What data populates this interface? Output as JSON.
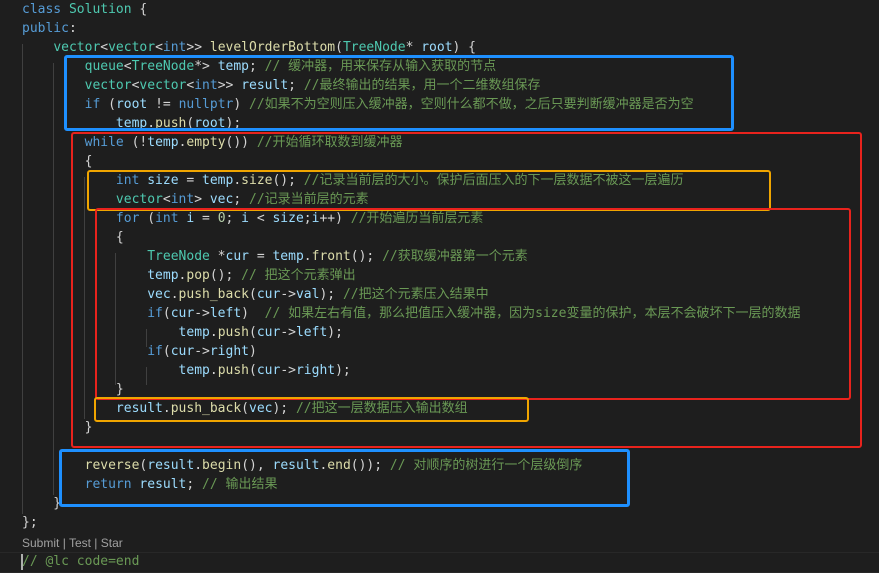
{
  "code": {
    "l01": {
      "a": "class ",
      "b": "Solution",
      " c": ""
    },
    "lines": [
      [
        [
          "kw",
          "class "
        ],
        [
          "ty",
          "Solution"
        ],
        [
          "pl",
          " {"
        ]
      ],
      [
        [
          "kw",
          "public"
        ],
        [
          "pl",
          ":"
        ]
      ],
      [
        [
          "pl",
          "    "
        ],
        [
          "ty",
          "vector"
        ],
        [
          "pl",
          "<"
        ],
        [
          "ty",
          "vector"
        ],
        [
          "pl",
          "<"
        ],
        [
          "kw",
          "int"
        ],
        [
          "pl",
          ">> "
        ],
        [
          "fn",
          "levelOrderBottom"
        ],
        [
          "pl",
          "("
        ],
        [
          "ty",
          "TreeNode"
        ],
        [
          "pl",
          "* "
        ],
        [
          "vr",
          "root"
        ],
        [
          "pl",
          ") {"
        ]
      ],
      [
        [
          "pl",
          "        "
        ],
        [
          "ty",
          "queue"
        ],
        [
          "pl",
          "<"
        ],
        [
          "ty",
          "TreeNode"
        ],
        [
          "pl",
          "*> "
        ],
        [
          "vr",
          "temp"
        ],
        [
          "pl",
          "; "
        ],
        [
          "cm",
          "// 缓冲器，用来保存从输入获取的节点"
        ]
      ],
      [
        [
          "pl",
          "        "
        ],
        [
          "ty",
          "vector"
        ],
        [
          "pl",
          "<"
        ],
        [
          "ty",
          "vector"
        ],
        [
          "pl",
          "<"
        ],
        [
          "kw",
          "int"
        ],
        [
          "pl",
          ">> "
        ],
        [
          "vr",
          "result"
        ],
        [
          "pl",
          "; "
        ],
        [
          "cm",
          "//最终输出的结果，用一个二维数组保存"
        ]
      ],
      [
        [
          "pl",
          "        "
        ],
        [
          "kw",
          "if"
        ],
        [
          "pl",
          " ("
        ],
        [
          "vr",
          "root"
        ],
        [
          "pl",
          " != "
        ],
        [
          "kw",
          "nullptr"
        ],
        [
          "pl",
          ") "
        ],
        [
          "cm",
          "//如果不为空则压入缓冲器，空则什么都不做，之后只要判断缓冲器是否为空"
        ]
      ],
      [
        [
          "pl",
          "            "
        ],
        [
          "vr",
          "temp"
        ],
        [
          "pl",
          "."
        ],
        [
          "fn",
          "push"
        ],
        [
          "pl",
          "("
        ],
        [
          "vr",
          "root"
        ],
        [
          "pl",
          ");"
        ]
      ],
      [
        [
          "pl",
          "        "
        ],
        [
          "kw",
          "while"
        ],
        [
          "pl",
          " (!"
        ],
        [
          "vr",
          "temp"
        ],
        [
          "pl",
          "."
        ],
        [
          "fn",
          "empty"
        ],
        [
          "pl",
          "()) "
        ],
        [
          "cm",
          "//开始循环取数到缓冲器"
        ]
      ],
      [
        [
          "pl",
          "        {"
        ]
      ],
      [
        [
          "pl",
          "            "
        ],
        [
          "kw",
          "int"
        ],
        [
          "pl",
          " "
        ],
        [
          "vr",
          "size"
        ],
        [
          "pl",
          " = "
        ],
        [
          "vr",
          "temp"
        ],
        [
          "pl",
          "."
        ],
        [
          "fn",
          "size"
        ],
        [
          "pl",
          "(); "
        ],
        [
          "cm",
          "//记录当前层的大小。保护后面压入的下一层数据不被这一层遍历"
        ]
      ],
      [
        [
          "pl",
          "            "
        ],
        [
          "ty",
          "vector"
        ],
        [
          "pl",
          "<"
        ],
        [
          "kw",
          "int"
        ],
        [
          "pl",
          "> "
        ],
        [
          "vr",
          "vec"
        ],
        [
          "pl",
          "; "
        ],
        [
          "cm",
          "//记录当前层的元素"
        ]
      ],
      [
        [
          "pl",
          "            "
        ],
        [
          "kw",
          "for"
        ],
        [
          "pl",
          " ("
        ],
        [
          "kw",
          "int"
        ],
        [
          "pl",
          " "
        ],
        [
          "vr",
          "i"
        ],
        [
          "pl",
          " = "
        ],
        [
          "nm",
          "0"
        ],
        [
          "pl",
          "; "
        ],
        [
          "vr",
          "i"
        ],
        [
          "pl",
          " < "
        ],
        [
          "vr",
          "size"
        ],
        [
          "pl",
          ";"
        ],
        [
          "vr",
          "i"
        ],
        [
          "pl",
          "++) "
        ],
        [
          "cm",
          "//开始遍历当前层元素"
        ]
      ],
      [
        [
          "pl",
          "            {"
        ]
      ],
      [
        [
          "pl",
          "                "
        ],
        [
          "ty",
          "TreeNode"
        ],
        [
          "pl",
          " *"
        ],
        [
          "vr",
          "cur"
        ],
        [
          "pl",
          " = "
        ],
        [
          "vr",
          "temp"
        ],
        [
          "pl",
          "."
        ],
        [
          "fn",
          "front"
        ],
        [
          "pl",
          "(); "
        ],
        [
          "cm",
          "//获取缓冲器第一个元素"
        ]
      ],
      [
        [
          "pl",
          "                "
        ],
        [
          "vr",
          "temp"
        ],
        [
          "pl",
          "."
        ],
        [
          "fn",
          "pop"
        ],
        [
          "pl",
          "(); "
        ],
        [
          "cm",
          "// 把这个元素弹出"
        ]
      ],
      [
        [
          "pl",
          "                "
        ],
        [
          "vr",
          "vec"
        ],
        [
          "pl",
          "."
        ],
        [
          "fn",
          "push_back"
        ],
        [
          "pl",
          "("
        ],
        [
          "vr",
          "cur"
        ],
        [
          "pl",
          "->"
        ],
        [
          "vr",
          "val"
        ],
        [
          "pl",
          "); "
        ],
        [
          "cm",
          "//把这个元素压入结果中"
        ]
      ],
      [
        [
          "pl",
          "                "
        ],
        [
          "kw",
          "if"
        ],
        [
          "pl",
          "("
        ],
        [
          "vr",
          "cur"
        ],
        [
          "pl",
          "->"
        ],
        [
          "vr",
          "left"
        ],
        [
          "pl",
          ")  "
        ],
        [
          "cm",
          "// 如果左右有值，那么把值压入缓冲器，因为size变量的保护，本层不会破坏下一层的数据"
        ]
      ],
      [
        [
          "pl",
          "                    "
        ],
        [
          "vr",
          "temp"
        ],
        [
          "pl",
          "."
        ],
        [
          "fn",
          "push"
        ],
        [
          "pl",
          "("
        ],
        [
          "vr",
          "cur"
        ],
        [
          "pl",
          "->"
        ],
        [
          "vr",
          "left"
        ],
        [
          "pl",
          ");"
        ]
      ],
      [
        [
          "pl",
          "                "
        ],
        [
          "kw",
          "if"
        ],
        [
          "pl",
          "("
        ],
        [
          "vr",
          "cur"
        ],
        [
          "pl",
          "->"
        ],
        [
          "vr",
          "right"
        ],
        [
          "pl",
          ")"
        ]
      ],
      [
        [
          "pl",
          "                    "
        ],
        [
          "vr",
          "temp"
        ],
        [
          "pl",
          "."
        ],
        [
          "fn",
          "push"
        ],
        [
          "pl",
          "("
        ],
        [
          "vr",
          "cur"
        ],
        [
          "pl",
          "->"
        ],
        [
          "vr",
          "right"
        ],
        [
          "pl",
          ");"
        ]
      ],
      [
        [
          "pl",
          "            }"
        ]
      ],
      [
        [
          "pl",
          "            "
        ],
        [
          "vr",
          "result"
        ],
        [
          "pl",
          "."
        ],
        [
          "fn",
          "push_back"
        ],
        [
          "pl",
          "("
        ],
        [
          "vr",
          "vec"
        ],
        [
          "pl",
          "); "
        ],
        [
          "cm",
          "//把这一层数据压入输出数组"
        ]
      ],
      [
        [
          "pl",
          "        }"
        ]
      ],
      [
        [
          "pl",
          ""
        ]
      ],
      [
        [
          "pl",
          "        "
        ],
        [
          "fn",
          "reverse"
        ],
        [
          "pl",
          "("
        ],
        [
          "vr",
          "result"
        ],
        [
          "pl",
          "."
        ],
        [
          "fn",
          "begin"
        ],
        [
          "pl",
          "(), "
        ],
        [
          "vr",
          "result"
        ],
        [
          "pl",
          "."
        ],
        [
          "fn",
          "end"
        ],
        [
          "pl",
          "()); "
        ],
        [
          "cm",
          "// 对顺序的树进行一个层级倒序"
        ]
      ],
      [
        [
          "pl",
          "        "
        ],
        [
          "kw",
          "return"
        ],
        [
          "pl",
          " "
        ],
        [
          "vr",
          "result"
        ],
        [
          "pl",
          "; "
        ],
        [
          "cm",
          "// 输出结果"
        ]
      ],
      [
        [
          "pl",
          "    }"
        ]
      ],
      [
        [
          "pl",
          "};"
        ]
      ]
    ],
    "last_line": "// @lc code=end"
  },
  "codelens": {
    "submit": "Submit",
    "sep1": " | ",
    "test": "Test",
    "sep2": " | ",
    "star": "Star"
  },
  "colors": {
    "background": "#1e1e1e",
    "keyword": "#569cd6",
    "type": "#4ec9b0",
    "function": "#dcdcaa",
    "variable": "#9cdcfe",
    "comment": "#6a9955",
    "number": "#b5cea8",
    "box_blue": "#1e90ff",
    "box_red": "#e8231d",
    "box_orange": "#f0a500"
  }
}
